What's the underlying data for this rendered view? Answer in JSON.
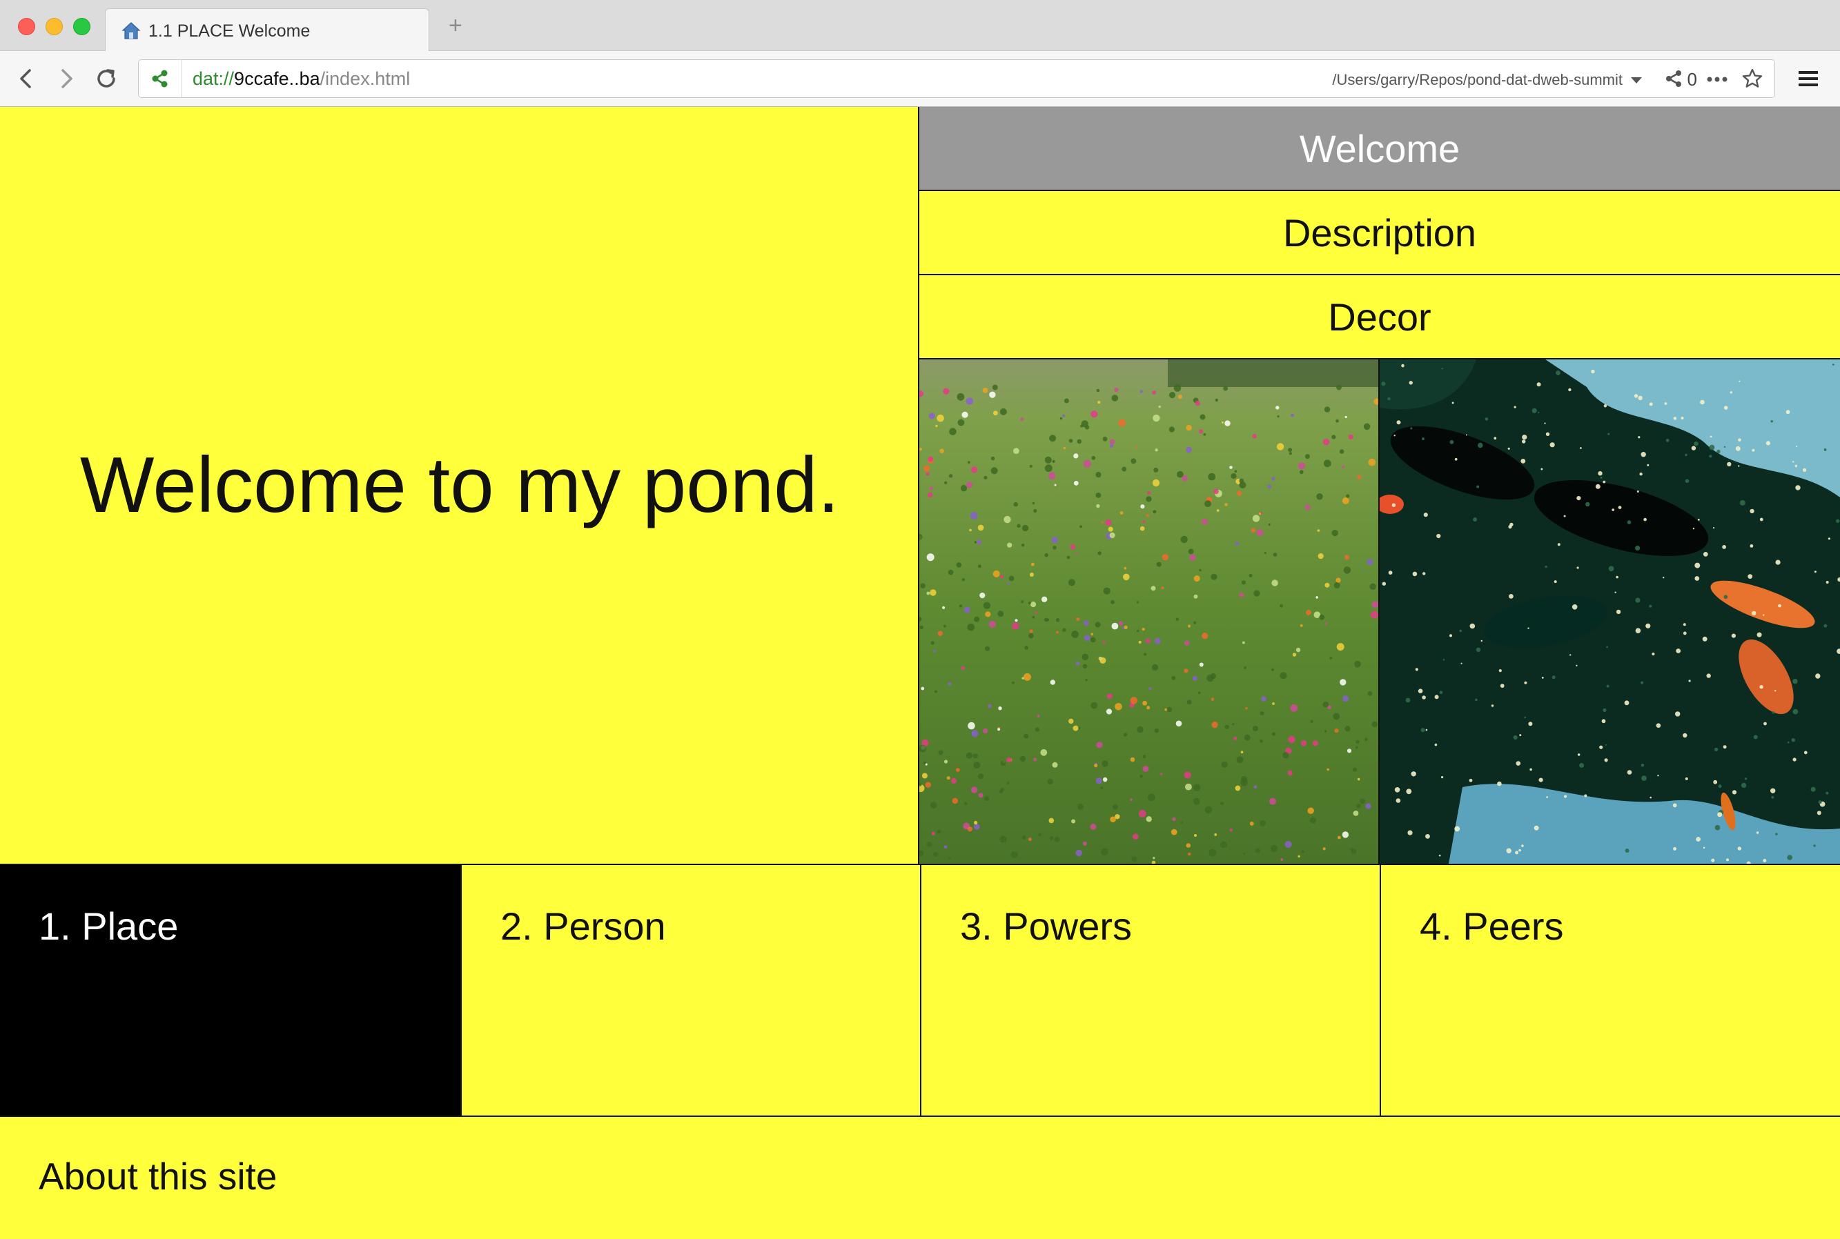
{
  "browser": {
    "tab_title": "1.1 PLACE Welcome",
    "new_tab_label": "+",
    "url_scheme": "dat://",
    "url_host": "9ccafe..ba",
    "url_path": "/index.html",
    "folder_path": "/Users/garry/Repos/pond-dat-dweb-summit",
    "peer_count": "0"
  },
  "hero": {
    "title": "Welcome to my pond."
  },
  "menu": {
    "items": [
      {
        "label": "Welcome",
        "active": true
      },
      {
        "label": "Description",
        "active": false
      },
      {
        "label": "Decor",
        "active": false
      }
    ]
  },
  "sections": [
    {
      "label": "1. Place",
      "active": true
    },
    {
      "label": "2. Person",
      "active": false
    },
    {
      "label": "3. Powers",
      "active": false
    },
    {
      "label": "4. Peers",
      "active": false
    }
  ],
  "footer": {
    "about_label": "About this site"
  },
  "colors": {
    "page_bg": "#ffff3b",
    "active_menu_bg": "#999999",
    "active_section_bg": "#000000",
    "url_scheme": "#2e8b2e"
  },
  "images": [
    {
      "name": "wildflower-meadow-image"
    },
    {
      "name": "koi-pond-image"
    }
  ]
}
